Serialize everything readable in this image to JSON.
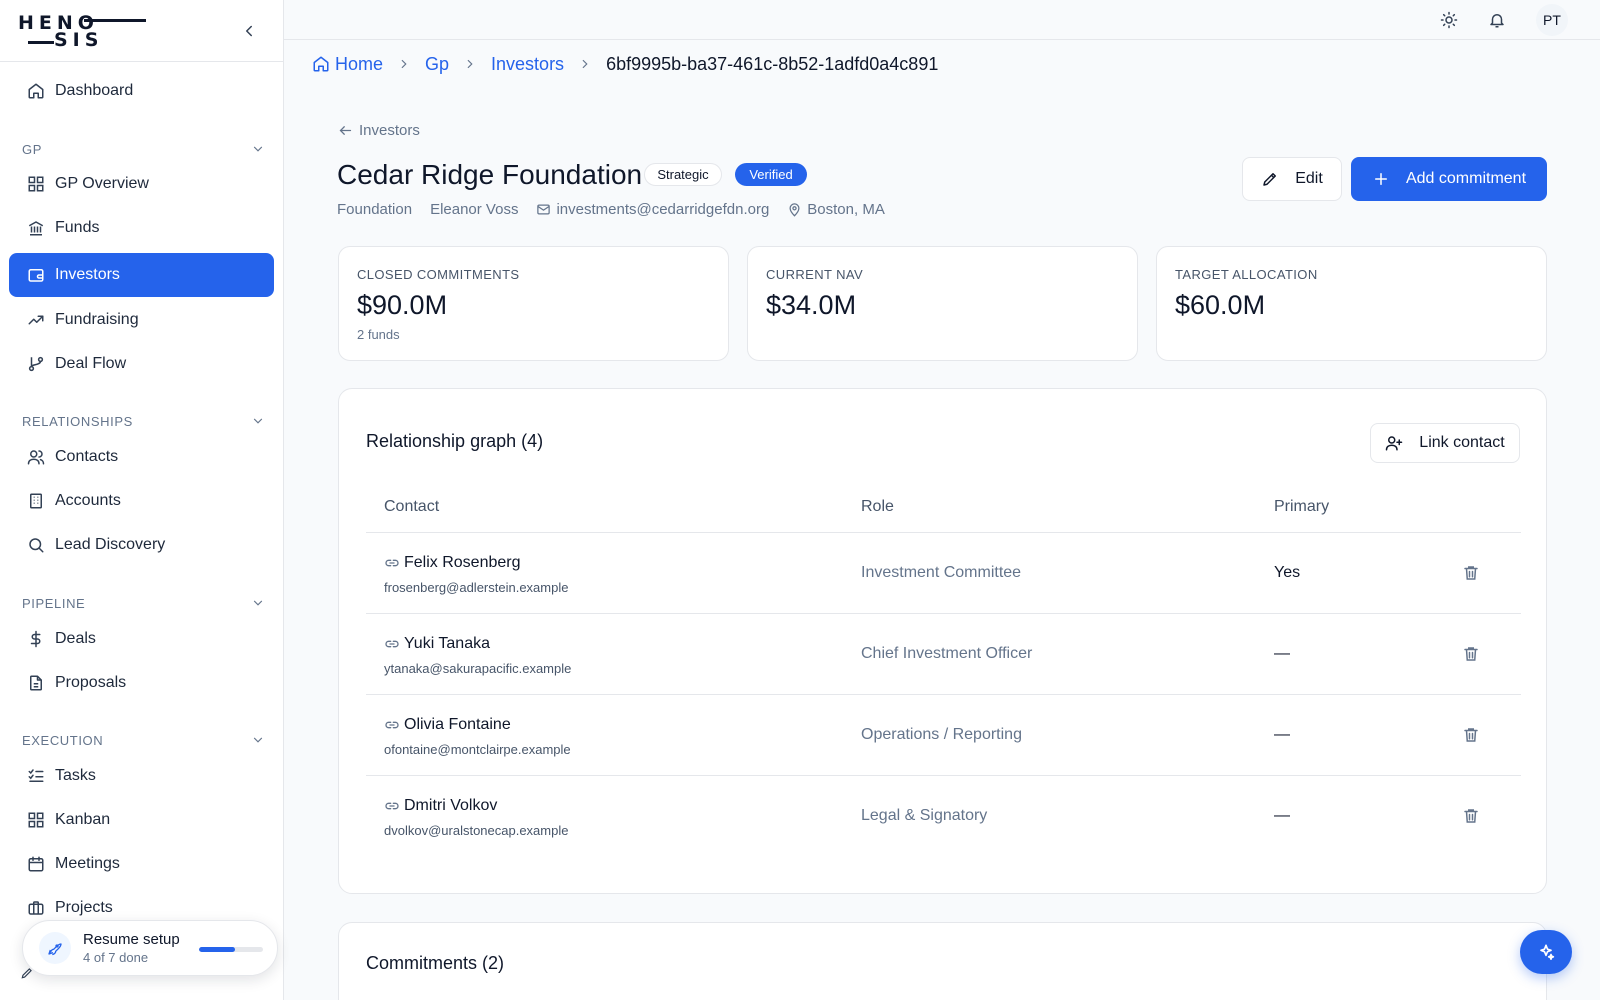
{
  "brand": {
    "logo_line1": "HENO",
    "logo_line2": "SIS"
  },
  "sidebar": {
    "dashboard": "Dashboard",
    "sections": {
      "gp": "GP",
      "relationships": "RELATIONSHIPS",
      "pipeline": "PIPELINE",
      "execution": "EXECUTION"
    },
    "items": {
      "gp_overview": "GP Overview",
      "funds": "Funds",
      "investors": "Investors",
      "fundraising": "Fundraising",
      "deal_flow": "Deal Flow",
      "contacts": "Contacts",
      "accounts": "Accounts",
      "lead_discovery": "Lead Discovery",
      "deals": "Deals",
      "proposals": "Proposals",
      "tasks": "Tasks",
      "kanban": "Kanban",
      "meetings": "Meetings",
      "projects": "Projects"
    },
    "active_item": "Investors",
    "setup": {
      "title": "Resume setup",
      "subtitle": "4 of 7 done",
      "progress_percent": 57
    }
  },
  "topbar": {
    "avatar_initials": "PT"
  },
  "breadcrumb": {
    "home": "Home",
    "gp": "Gp",
    "investors": "Investors",
    "current": "6bf9995b-ba37-461c-8b52-1adfd0a4c891"
  },
  "header": {
    "back_label": "Investors",
    "title": "Cedar Ridge Foundation",
    "badges": {
      "strategic": "Strategic",
      "verified": "Verified"
    },
    "meta": {
      "type": "Foundation",
      "contact": "Eleanor Voss",
      "email": "investments@cedarridgefdn.org",
      "location": "Boston, MA"
    },
    "edit_label": "Edit",
    "add_commitment_label": "Add commitment"
  },
  "stats": {
    "closed": {
      "label": "CLOSED COMMITMENTS",
      "value": "$90.0M",
      "sub": "2 funds"
    },
    "nav": {
      "label": "CURRENT NAV",
      "value": "$34.0M"
    },
    "target": {
      "label": "TARGET ALLOCATION",
      "value": "$60.0M"
    }
  },
  "relationship_graph": {
    "title": "Relationship graph (4)",
    "link_contact_label": "Link contact",
    "columns": {
      "contact": "Contact",
      "role": "Role",
      "primary": "Primary"
    },
    "rows": [
      {
        "name": "Felix Rosenberg",
        "email": "frosenberg@adlerstein.example",
        "role": "Investment Committee",
        "primary": "Yes"
      },
      {
        "name": "Yuki Tanaka",
        "email": "ytanaka@sakurapacific.example",
        "role": "Chief Investment Officer",
        "primary": "—"
      },
      {
        "name": "Olivia Fontaine",
        "email": "ofontaine@montclairpe.example",
        "role": "Operations / Reporting",
        "primary": "—"
      },
      {
        "name": "Dmitri Volkov",
        "email": "dvolkov@uralstonecap.example",
        "role": "Legal & Signatory",
        "primary": "—"
      }
    ]
  },
  "commitments": {
    "title": "Commitments (2)"
  },
  "colors": {
    "accent": "#2563eb",
    "border": "#e5e7eb",
    "muted_text": "#64748b"
  }
}
